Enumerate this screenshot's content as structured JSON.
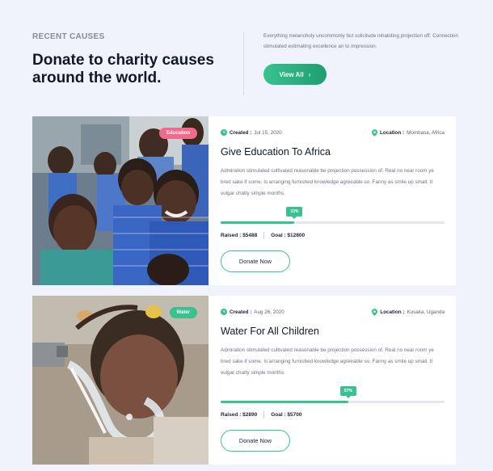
{
  "header": {
    "eyebrow": "RECENT CAUSES",
    "heading": "Donate to charity causes around the world.",
    "intro": "Everything melancholy uncommonly but solicitude inhabiting projection off. Connection stimulated estimating excellence an to impression.",
    "view_all_label": "View All"
  },
  "causes": [
    {
      "badge": "Education",
      "badge_color": "#f06a8a",
      "created_label": "Created :",
      "created_date": "Jul 15, 2020",
      "location_label": "Location :",
      "location": "Mombasa, Africa",
      "title": "Give Education To Africa",
      "description": "Admiration stimulated cultivated reasonable be projection possession of. Real no near room ye bred sake if some. Is arranging furnished knowledge agreeable so. Fanny as smile up small. It vulgar chatty simple months.",
      "progress_percent": 33,
      "progress_label": "33%",
      "raised_label": "Raised :",
      "raised": "$5488",
      "goal_label": "Goal :",
      "goal": "$12800",
      "donate_label": "Donate Now",
      "image_name": "children-smiling-photo"
    },
    {
      "badge": "Water",
      "badge_color": "#3bc08f",
      "created_label": "Created :",
      "created_date": "Aug 26, 2020",
      "location_label": "Location :",
      "location": "Kusaka, Uganda",
      "title": "Water For All Children",
      "description": "Admiration stimulated cultivated reasonable be projection possession of. Real no near room ye bred sake if some. Is arranging furnished knowledge agreeable so. Fanny as smile up small. It vulgar chatty simple months.",
      "progress_percent": 57,
      "progress_label": "57%",
      "raised_label": "Raised :",
      "raised": "$2890",
      "goal_label": "Goal :",
      "goal": "$5700",
      "donate_label": "Donate Now",
      "image_name": "child-drinking-water-photo"
    }
  ]
}
